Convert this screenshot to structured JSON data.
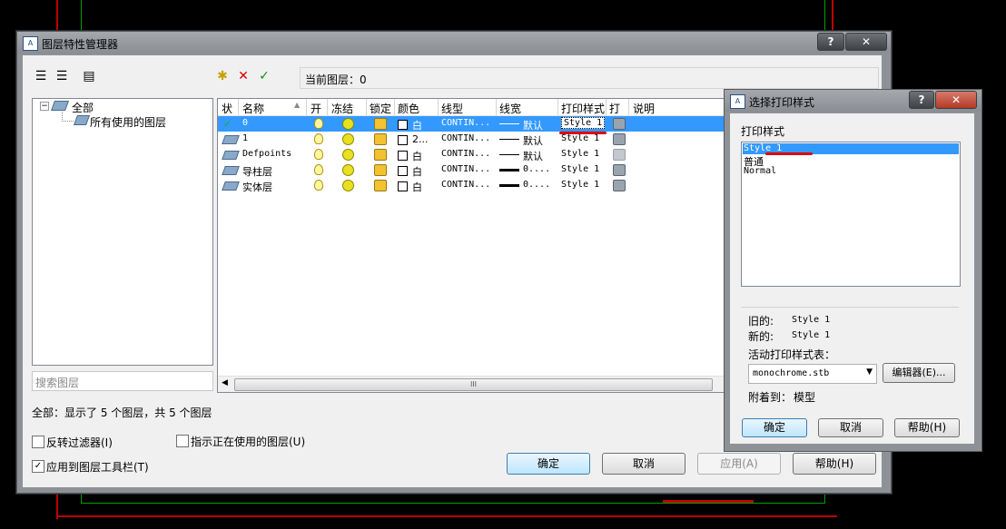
{
  "main_dialog": {
    "title": "图层特性管理器",
    "current_layer_label": "当前图层：",
    "current_layer_value": "0",
    "tree": {
      "root": "全部",
      "child": "所有使用的图层"
    },
    "search_placeholder": "搜索图层",
    "columns": [
      "状",
      "名称",
      "开",
      "冻结",
      "锁定",
      "颜色",
      "线型",
      "线宽",
      "打印样式",
      "打",
      "说明"
    ],
    "layers": [
      {
        "status": "✓",
        "name": "0",
        "color": "白",
        "linetype": "CONTIN...",
        "lineweight": "默认",
        "plot_style": "Style 1"
      },
      {
        "status": "",
        "name": "1",
        "color": "2...",
        "linetype": "CONTIN...",
        "lineweight": "默认",
        "plot_style": "Style 1"
      },
      {
        "status": "",
        "name": "Defpoints",
        "color": "白",
        "linetype": "CONTIN...",
        "lineweight": "默认",
        "plot_style": "Style 1"
      },
      {
        "status": "",
        "name": "导柱层",
        "color": "白",
        "linetype": "CONTIN...",
        "lineweight": "0....",
        "plot_style": "Style 1"
      },
      {
        "status": "",
        "name": "实体层",
        "color": "白",
        "linetype": "CONTIN...",
        "lineweight": "0....",
        "plot_style": "Style 1"
      }
    ],
    "status_text": "全部：显示了 5 个图层，共 5 个图层",
    "invert_filter": "反转过滤器(I)",
    "indicate_in_use": "指示正在使用的图层(U)",
    "apply_toolbar": "应用到图层工具栏(T)",
    "ok": "确定",
    "cancel": "取消",
    "apply": "应用(A)",
    "help": "帮助(H)",
    "scroll_grip": "III"
  },
  "plot_style_dialog": {
    "title": "选择打印样式",
    "section_label": "打印样式",
    "styles": [
      "Style 1",
      "普通",
      "Normal"
    ],
    "selected": "Style 1",
    "old_label": "旧的:",
    "old_value": "Style 1",
    "new_label": "新的:",
    "new_value": "Style 1",
    "active_table_label": "活动打印样式表：",
    "active_table_value": "monochrome.stb",
    "editor_button": "编辑器(E)...",
    "attached_label": "附着到：",
    "attached_value": "模型",
    "ok": "确定",
    "cancel": "取消",
    "help": "帮助(H)"
  },
  "colors": {
    "selection": "#3399ff",
    "annotation_red": "#e00000",
    "cad_background": "#000000"
  }
}
